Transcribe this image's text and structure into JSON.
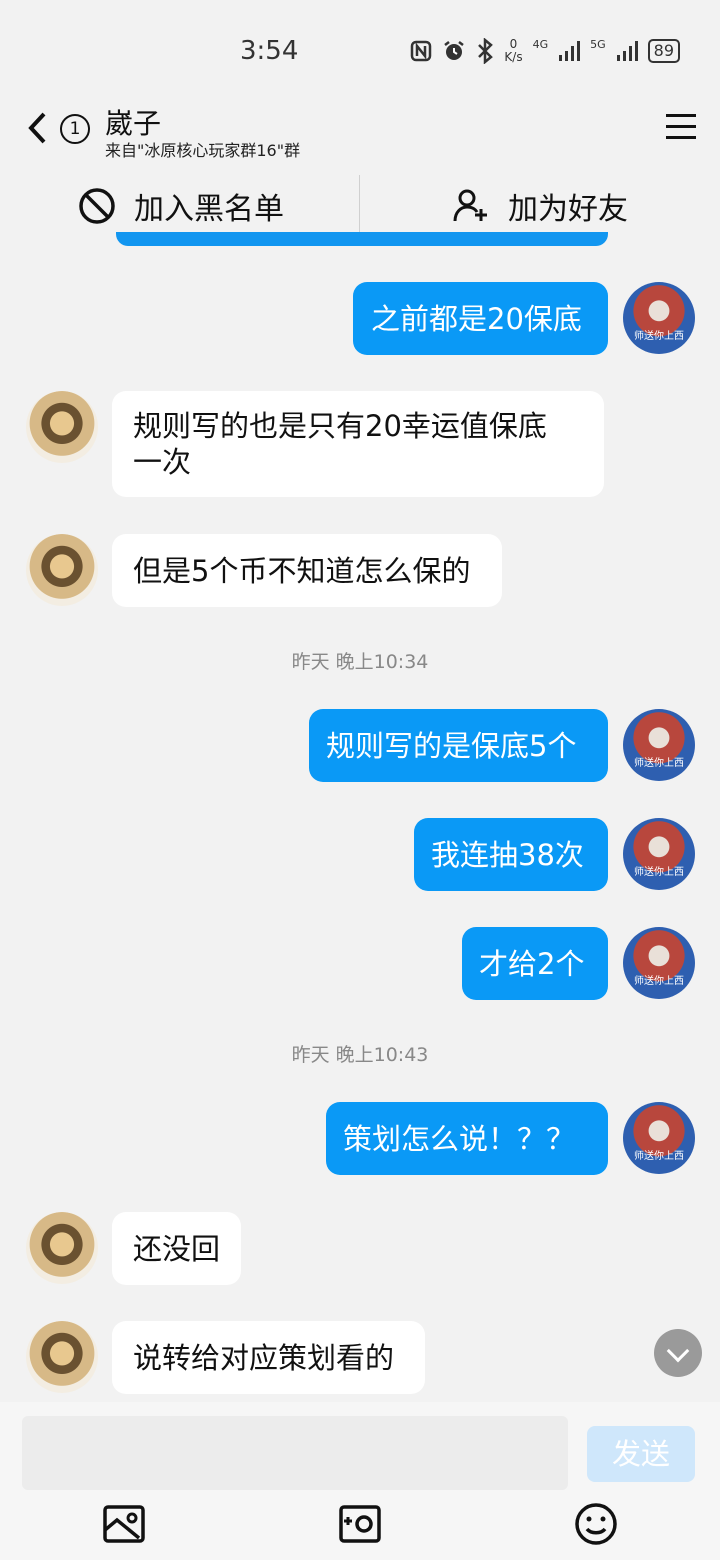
{
  "status_bar": {
    "time": "3:54",
    "net_speed_value": "0",
    "net_speed_unit": "K/s",
    "signal_1": "4G",
    "signal_2": "5G",
    "battery": "89",
    "icons": [
      "nfc-icon",
      "alarm-icon",
      "bluetooth-icon",
      "signal-icon",
      "signal-icon",
      "battery-icon"
    ]
  },
  "header": {
    "name": "崴子",
    "source": "来自\"冰原核心玩家群16\"群",
    "unread_count": "1"
  },
  "actions": {
    "blacklist": "加入黑名单",
    "add_friend": "加为好友"
  },
  "messages": [
    {
      "from": "self",
      "text": "之前都是20保底"
    },
    {
      "from": "other",
      "text_line1": "规则写的也是只有20幸运值保底",
      "text_line2": "一次"
    },
    {
      "from": "other",
      "text": "但是5个币不知道怎么保的"
    },
    {
      "timestamp": "昨天 晚上10:34"
    },
    {
      "from": "self",
      "text": "规则写的是保底5个"
    },
    {
      "from": "self",
      "text": "我连抽38次"
    },
    {
      "from": "self",
      "text": "才给2个"
    },
    {
      "timestamp": "昨天 晚上10:43"
    },
    {
      "from": "self",
      "text": "策划怎么说！？？"
    },
    {
      "from": "other",
      "text": "还没回"
    },
    {
      "from": "other",
      "text": "说转给对应策划看的"
    }
  ],
  "avatar_self_caption": "师送你上西",
  "input": {
    "value": "",
    "send_label": "发送"
  },
  "colors": {
    "accent": "#0a99f6",
    "background": "#f2f2f2"
  }
}
